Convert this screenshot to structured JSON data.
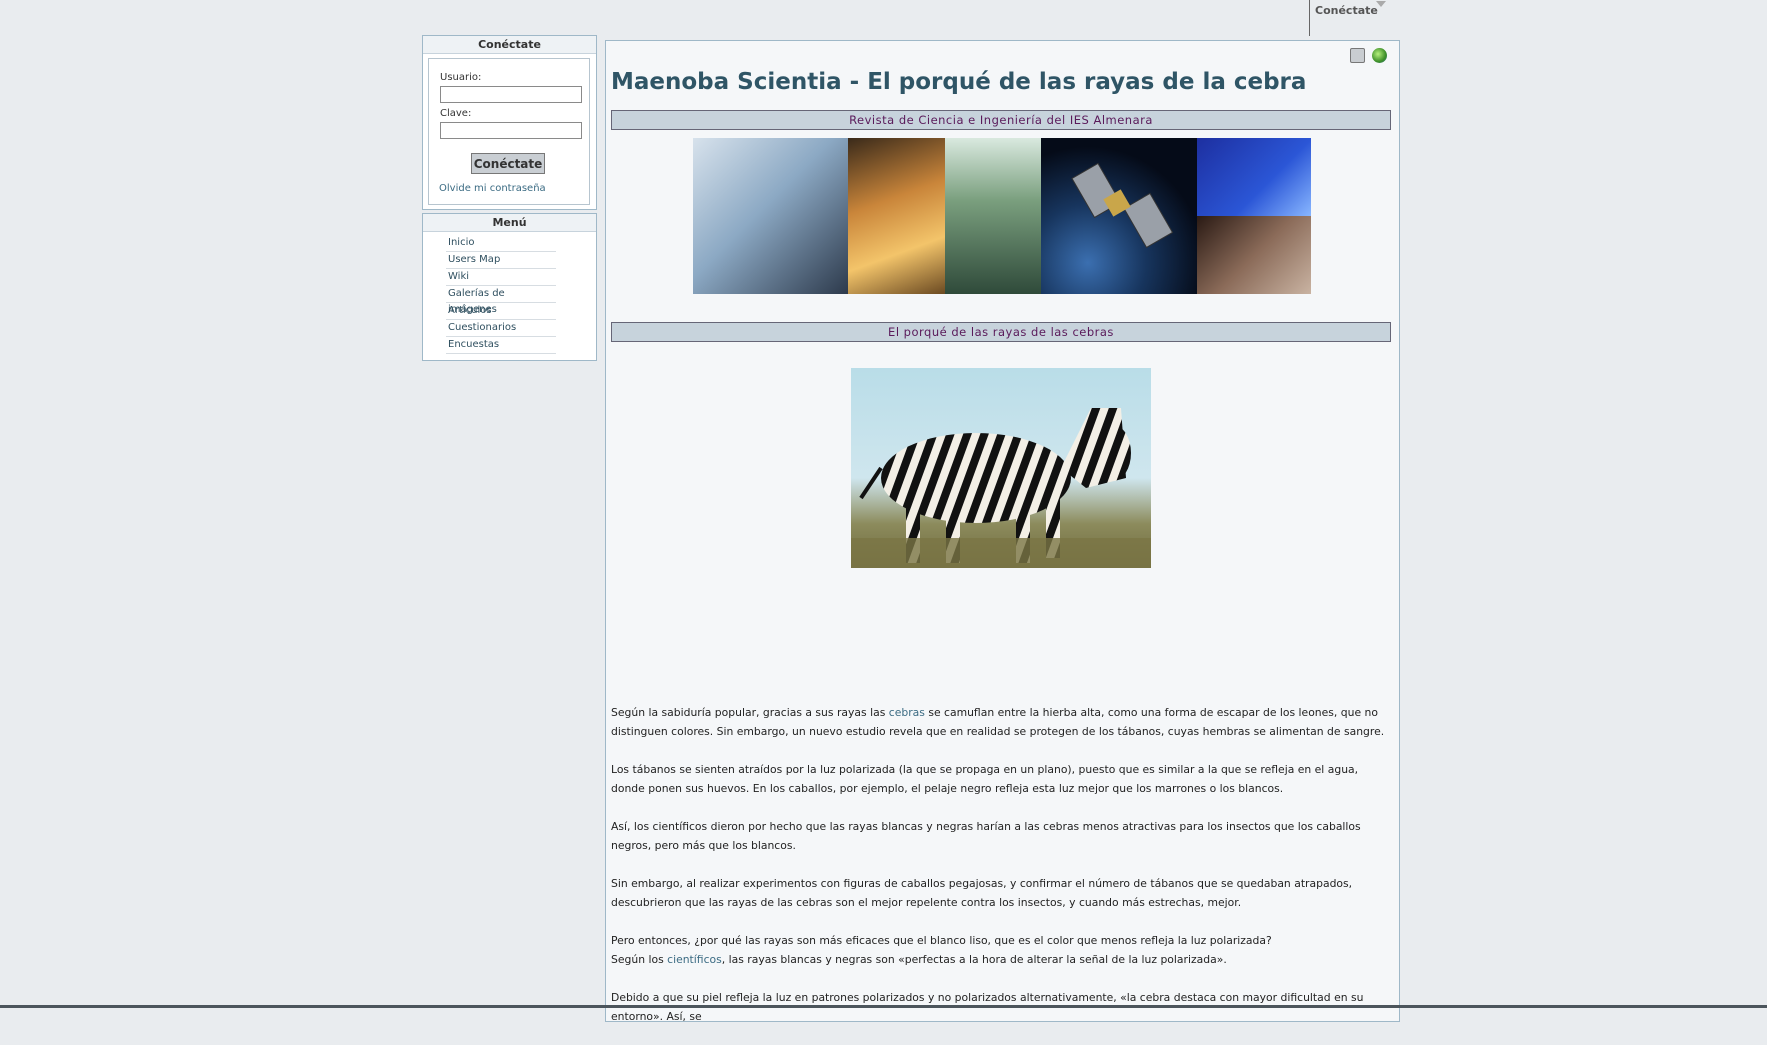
{
  "top_login": {
    "label": "Conéctate"
  },
  "login_module": {
    "title": "Conéctate",
    "user_label": "Usuario:",
    "user_value": "",
    "password_label": "Clave:",
    "password_value": "",
    "submit_label": "Conéctate",
    "forgot_link": "Olvide mi contraseña"
  },
  "menu_module": {
    "title": "Menú",
    "items": [
      {
        "label": "Inicio"
      },
      {
        "label": "Users Map"
      },
      {
        "label": "Wiki"
      },
      {
        "label": "Galerías de imágenes"
      },
      {
        "label": "Artículos"
      },
      {
        "label": "Cuestionarios"
      },
      {
        "label": "Encuestas"
      }
    ]
  },
  "main": {
    "title": "Maenoba Scientia - El porqué de las rayas de la cebra",
    "magazine_band": "Revista de Ciencia e Ingeniería del IES Almenara",
    "article_band": "El porqué de las rayas de las cebras",
    "icons": [
      "print-icon",
      "globe-icon"
    ],
    "paragraphs": [
      {
        "pre": "Según la sabiduría popular, gracias a sus rayas las ",
        "link": "cebras",
        "post": " se camuflan entre la hierba alta, como una forma de escapar de los leones, que no distinguen colores. Sin embargo, un nuevo estudio revela que en realidad se protegen de los tábanos, cuyas hembras se alimentan de sangre."
      },
      {
        "text": "Los tábanos se sienten atraídos por la luz polarizada (la que se propaga en un plano), puesto que es similar a la que se refleja en el agua, donde ponen sus huevos. En los caballos, por ejemplo, el pelaje negro refleja esta luz mejor que los marrones o los blancos."
      },
      {
        "text": "Así, los científicos dieron por hecho que las rayas blancas y negras harían a las cebras menos atractivas para los insectos que los caballos negros, pero más que los blancos."
      },
      {
        "text": "Sin embargo, al realizar experimentos con figuras de caballos pegajosas, y confirmar el número de tábanos que se quedaban atrapados, descubrieron que las rayas de las cebras son el mejor repelente contra los insectos, y cuando más estrechas, mejor."
      },
      {
        "line1": "Pero entonces, ¿por qué las rayas son más eficaces que el blanco liso, que es el color que menos refleja la luz polarizada?",
        "pre": "Según los ",
        "link": "científicos",
        "post": ", las rayas blancas y negras son «perfectas a la hora de alterar la señal de la luz polarizada»."
      },
      {
        "text": "Debido a que su piel refleja la luz en patrones polarizados y no polarizados alternativamente, «la cebra destaca con mayor dificultad en su entorno». Así, se"
      }
    ]
  },
  "colors": {
    "page_bg": "#e9ecef",
    "title": "#2f5566",
    "band_bg": "#c7d3dc",
    "band_text": "#5a1a5a",
    "link": "#3b6b83"
  }
}
